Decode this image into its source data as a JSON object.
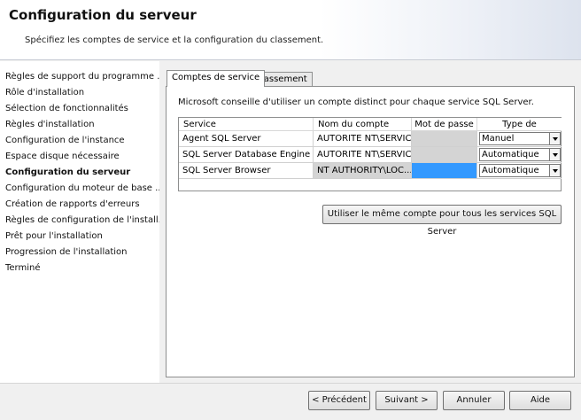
{
  "header": {
    "title": "Configuration du serveur",
    "subtitle": "Spécifiez les comptes de service et la configuration du classement."
  },
  "nav": {
    "items": [
      {
        "label": "Règles de support du programme ..."
      },
      {
        "label": "Rôle d'installation"
      },
      {
        "label": "Sélection de fonctionnalités"
      },
      {
        "label": "Règles d'installation"
      },
      {
        "label": "Configuration de l'instance"
      },
      {
        "label": "Espace disque nécessaire"
      },
      {
        "label": "Configuration du serveur",
        "active": true
      },
      {
        "label": "Configuration du moteur de base ..."
      },
      {
        "label": "Création de rapports d'erreurs"
      },
      {
        "label": "Règles de configuration de l'install..."
      },
      {
        "label": "Prêt pour l'installation"
      },
      {
        "label": "Progression de l'installation"
      },
      {
        "label": "Terminé"
      }
    ]
  },
  "tabs": [
    {
      "label": "Comptes de service",
      "active": true
    },
    {
      "label": "Classement",
      "active": false
    }
  ],
  "panel": {
    "info": "Microsoft conseille d'utiliser un compte distinct pour chaque service SQL Server.",
    "columns": [
      "Service",
      "Nom du compte",
      "Mot de passe",
      "Type de démarrage"
    ],
    "rows": [
      {
        "service": "Agent SQL Server",
        "account": "AUTORITE NT\\SERVIC...",
        "password": "",
        "startup": "Manuel"
      },
      {
        "service": "SQL Server Database Engine",
        "account": "AUTORITE NT\\SERVIC...",
        "password": "",
        "startup": "Automatique"
      },
      {
        "service": "SQL Server Browser",
        "account": "NT AUTHORITY\\LOC...",
        "password": "",
        "startup": "Automatique"
      }
    ],
    "same_account_button": "Utiliser le même compte pour tous les services SQL Server"
  },
  "footer": {
    "previous": "< Précédent",
    "next": "Suivant >",
    "cancel": "Annuler",
    "help": "Aide"
  },
  "colors": {
    "selected_cell": "#3399ff",
    "disabled_cell": "#d4d4d4"
  }
}
